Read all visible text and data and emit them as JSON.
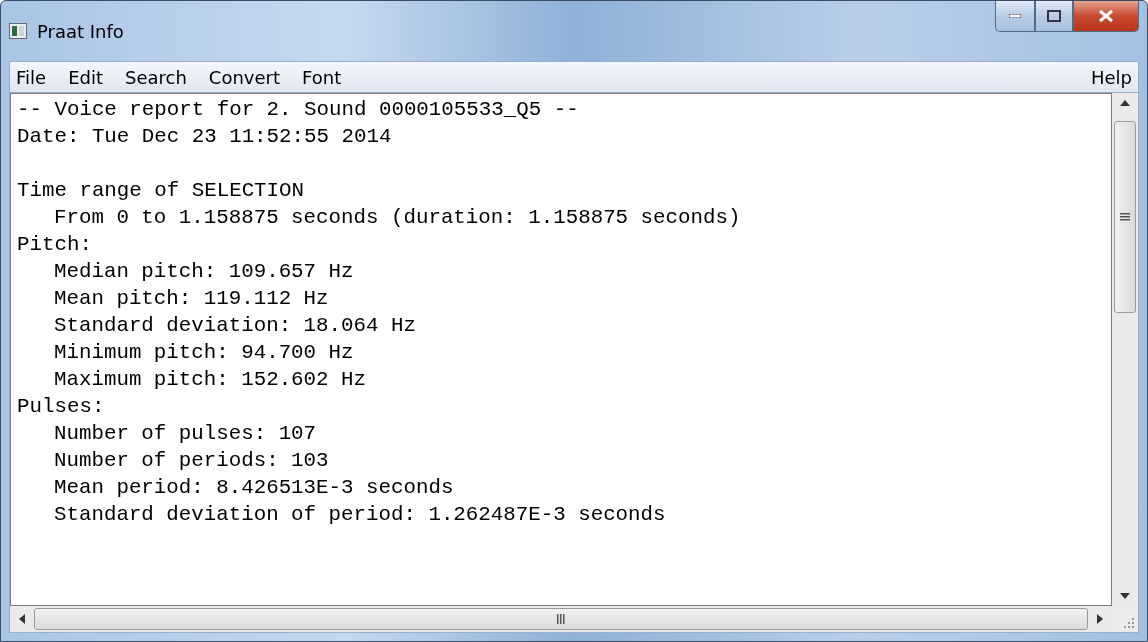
{
  "window": {
    "title": "Praat Info"
  },
  "menu": {
    "items": [
      "File",
      "Edit",
      "Search",
      "Convert",
      "Font"
    ],
    "help": "Help"
  },
  "report": {
    "header": [
      "-- Voice report for 2. Sound 0000105533_Q5 --",
      "Date: Tue Dec 23 11:52:55 2014"
    ],
    "sections": [
      {
        "title": "Time range of SELECTION",
        "items": [
          "From 0 to 1.158875 seconds (duration: 1.158875 seconds)"
        ]
      },
      {
        "title": "Pitch:",
        "items": [
          "Median pitch: 109.657 Hz",
          "Mean pitch: 119.112 Hz",
          "Standard deviation: 18.064 Hz",
          "Minimum pitch: 94.700 Hz",
          "Maximum pitch: 152.602 Hz"
        ]
      },
      {
        "title": "Pulses:",
        "items": [
          "Number of pulses: 107",
          "Number of periods: 103",
          "Mean period: 8.426513E-3 seconds",
          "Standard deviation of period: 1.262487E-3 seconds"
        ]
      }
    ]
  }
}
